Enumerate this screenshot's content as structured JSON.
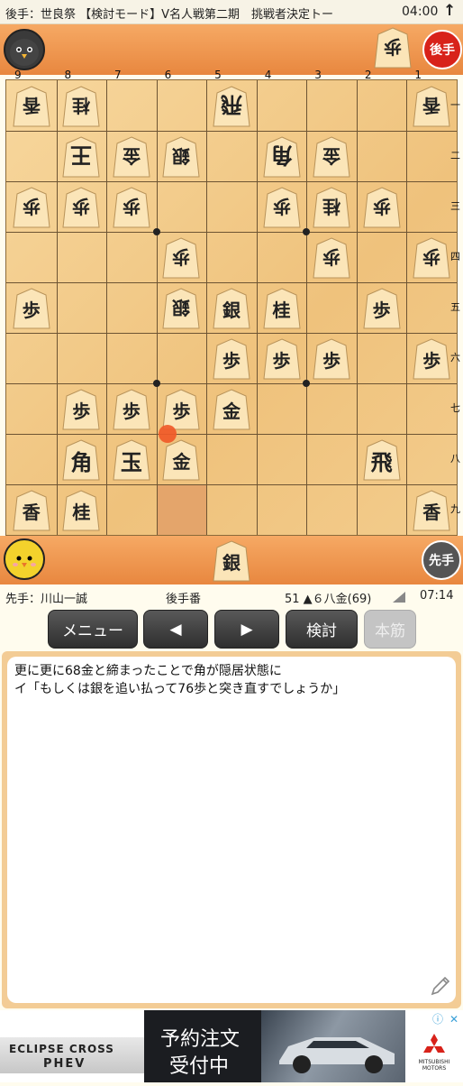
{
  "status_bar": {
    "title": "後手：世良祭 【検討モード】V名人戦第二期　挑戦者決定トー",
    "time": "04:00",
    "up_icon": "↑"
  },
  "gote": {
    "role": "後手",
    "hand": [
      {
        "kanji": "歩",
        "count": ""
      }
    ],
    "avatar_color": "#3a3a3a",
    "badge_color": "#d8221a"
  },
  "sente": {
    "role": "先手",
    "hand": [
      {
        "kanji": "銀",
        "count": ""
      }
    ],
    "avatar_color": "#f3d22c",
    "badge_color": "#555555"
  },
  "board": {
    "col_labels": [
      "9",
      "8",
      "7",
      "6",
      "5",
      "4",
      "3",
      "2",
      "1"
    ],
    "row_labels": [
      "一",
      "二",
      "三",
      "四",
      "五",
      "六",
      "七",
      "八",
      "九"
    ],
    "pieces": [
      {
        "col": 9,
        "row": 1,
        "kanji": "香",
        "side": "gote"
      },
      {
        "col": 8,
        "row": 1,
        "kanji": "桂",
        "side": "gote"
      },
      {
        "col": 5,
        "row": 1,
        "kanji": "飛",
        "side": "gote"
      },
      {
        "col": 1,
        "row": 1,
        "kanji": "香",
        "side": "gote"
      },
      {
        "col": 8,
        "row": 2,
        "kanji": "王",
        "side": "gote"
      },
      {
        "col": 7,
        "row": 2,
        "kanji": "金",
        "side": "gote"
      },
      {
        "col": 6,
        "row": 2,
        "kanji": "銀",
        "side": "gote"
      },
      {
        "col": 4,
        "row": 2,
        "kanji": "角",
        "side": "gote"
      },
      {
        "col": 3,
        "row": 2,
        "kanji": "金",
        "side": "gote"
      },
      {
        "col": 9,
        "row": 3,
        "kanji": "歩",
        "side": "gote"
      },
      {
        "col": 8,
        "row": 3,
        "kanji": "歩",
        "side": "gote"
      },
      {
        "col": 7,
        "row": 3,
        "kanji": "歩",
        "side": "gote"
      },
      {
        "col": 4,
        "row": 3,
        "kanji": "歩",
        "side": "gote"
      },
      {
        "col": 3,
        "row": 3,
        "kanji": "桂",
        "side": "gote"
      },
      {
        "col": 2,
        "row": 3,
        "kanji": "歩",
        "side": "gote"
      },
      {
        "col": 6,
        "row": 4,
        "kanji": "歩",
        "side": "gote"
      },
      {
        "col": 3,
        "row": 4,
        "kanji": "歩",
        "side": "gote"
      },
      {
        "col": 1,
        "row": 4,
        "kanji": "歩",
        "side": "gote"
      },
      {
        "col": 6,
        "row": 5,
        "kanji": "銀",
        "side": "gote"
      },
      {
        "col": 9,
        "row": 5,
        "kanji": "歩",
        "side": "sente"
      },
      {
        "col": 5,
        "row": 5,
        "kanji": "銀",
        "side": "sente"
      },
      {
        "col": 4,
        "row": 5,
        "kanji": "桂",
        "side": "sente"
      },
      {
        "col": 2,
        "row": 5,
        "kanji": "歩",
        "side": "sente"
      },
      {
        "col": 5,
        "row": 6,
        "kanji": "歩",
        "side": "sente"
      },
      {
        "col": 4,
        "row": 6,
        "kanji": "歩",
        "side": "sente"
      },
      {
        "col": 3,
        "row": 6,
        "kanji": "歩",
        "side": "sente"
      },
      {
        "col": 1,
        "row": 6,
        "kanji": "歩",
        "side": "sente"
      },
      {
        "col": 8,
        "row": 7,
        "kanji": "歩",
        "side": "sente"
      },
      {
        "col": 7,
        "row": 7,
        "kanji": "歩",
        "side": "sente"
      },
      {
        "col": 6,
        "row": 7,
        "kanji": "歩",
        "side": "sente"
      },
      {
        "col": 5,
        "row": 7,
        "kanji": "金",
        "side": "sente"
      },
      {
        "col": 8,
        "row": 8,
        "kanji": "角",
        "side": "sente"
      },
      {
        "col": 7,
        "row": 8,
        "kanji": "玉",
        "side": "sente"
      },
      {
        "col": 6,
        "row": 8,
        "kanji": "金",
        "side": "sente"
      },
      {
        "col": 2,
        "row": 8,
        "kanji": "飛",
        "side": "sente"
      },
      {
        "col": 9,
        "row": 9,
        "kanji": "香",
        "side": "sente"
      },
      {
        "col": 8,
        "row": 9,
        "kanji": "桂",
        "side": "sente"
      },
      {
        "col": 1,
        "row": 9,
        "kanji": "香",
        "side": "sente"
      }
    ],
    "last_move_from": {
      "col": 6,
      "row": 9
    },
    "last_move_to": {
      "col": 6,
      "row": 8
    }
  },
  "info": {
    "sente_player": "先手：川山一誠",
    "turn": "後手番",
    "move": "51 ▲６八金(69)",
    "clock": "07:14"
  },
  "buttons": {
    "menu": "メニュー",
    "prev": "◀",
    "next": "▶",
    "analyze": "検討",
    "main_line": "本筋"
  },
  "comment": {
    "lines": [
      "更に更に68金と締まったことで角が隠居状態に",
      "イ「もしくは銀を追い払って76歩と突き直すでしょうか」"
    ]
  },
  "ad": {
    "brand_line1": "ECLIPSE CROSS",
    "brand_line2": "PHEV",
    "headline1": "予約注文",
    "headline2": "受付中",
    "maker": "MITSUBISHI MOTORS",
    "info_icon": "ⓘ",
    "close_icon": "✕"
  }
}
